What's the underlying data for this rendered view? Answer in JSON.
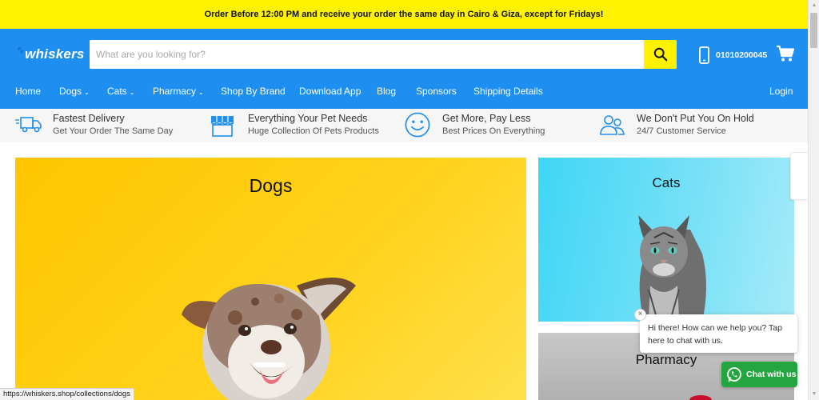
{
  "announcement": "Order Before 12:00 PM and receive your order the same day in Cairo & Giza, except for Fridays!",
  "header": {
    "logo": "whiskers",
    "search_placeholder": "What are you looking for?",
    "phone": "01010200045",
    "icons": {
      "search": "search-icon",
      "phone": "phone-icon",
      "cart": "cart-icon"
    }
  },
  "nav": {
    "items": [
      {
        "label": "Home",
        "dropdown": false
      },
      {
        "label": "Dogs",
        "dropdown": true
      },
      {
        "label": "Cats",
        "dropdown": true
      },
      {
        "label": "Pharmacy",
        "dropdown": true
      },
      {
        "label": "Shop By Brand",
        "dropdown": false
      },
      {
        "label": "Download App",
        "dropdown": false
      },
      {
        "label": "Blog",
        "dropdown": false
      },
      {
        "label": "Sponsors",
        "dropdown": false
      },
      {
        "label": "Shipping Details",
        "dropdown": false
      }
    ],
    "login": "Login",
    "chevron": "⌄"
  },
  "features": [
    {
      "title": "Fastest Delivery",
      "subtitle": "Get Your Order The Same Day",
      "icon": "delivery-truck-icon"
    },
    {
      "title": "Everything Your Pet Needs",
      "subtitle": "Huge Collection Of Pets Products",
      "icon": "store-icon"
    },
    {
      "title": "Get More, Pay Less",
      "subtitle": "Best Prices On Everything",
      "icon": "smiley-icon"
    },
    {
      "title": "We Don't Put You On Hold",
      "subtitle": "24/7 Customer Service",
      "icon": "customer-service-icon"
    }
  ],
  "collections": {
    "dogs": "Dogs",
    "cats": "Cats",
    "pharmacy": "Pharmacy"
  },
  "chat": {
    "message": "Hi there! How can we help you? Tap here to chat with us.",
    "button": "Chat with us",
    "close": "×"
  },
  "status_url": "https://whiskers.shop/collections/dogs",
  "colors": {
    "announcement_bg": "#fff200",
    "header_bg": "#1e8ff0",
    "accent_yellow": "#fff200",
    "whatsapp_green": "#25a540"
  }
}
